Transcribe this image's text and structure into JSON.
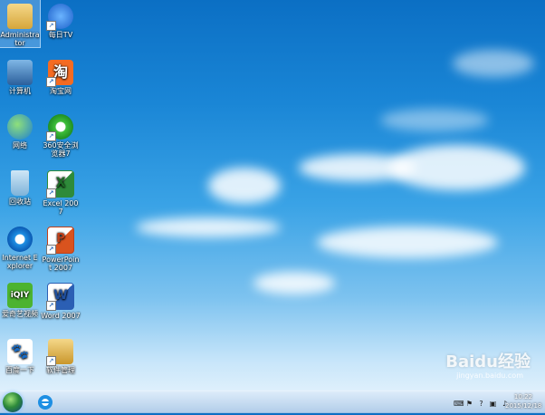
{
  "desktop": {
    "icons": [
      {
        "label": "Administrator",
        "icon": "folder-user-icon"
      },
      {
        "label": "每日TV",
        "icon": "tv-icon"
      },
      {
        "label": "计算机",
        "icon": "computer-icon"
      },
      {
        "label": "淘宝网",
        "icon": "taobao-icon"
      },
      {
        "label": "网络",
        "icon": "network-icon"
      },
      {
        "label": "360安全浏览器7",
        "icon": "360-browser-icon"
      },
      {
        "label": "回收站",
        "icon": "recycle-bin-icon"
      },
      {
        "label": "Excel 2007",
        "icon": "excel-icon"
      },
      {
        "label": "Internet Explorer",
        "icon": "ie-icon"
      },
      {
        "label": "PowerPoint 2007",
        "icon": "powerpoint-icon"
      },
      {
        "label": "爱奇艺视频",
        "icon": "iqiyi-icon"
      },
      {
        "label": "Word 2007",
        "icon": "word-icon"
      },
      {
        "label": "百度一下",
        "icon": "baidu-icon"
      },
      {
        "label": "软件管理",
        "icon": "software-manager-icon"
      }
    ]
  },
  "taskbar": {
    "clock_time": "10:22",
    "clock_date": "2015/12/18"
  },
  "watermark": {
    "text": "Baidu经验",
    "sub": "jingyan.baidu.com"
  }
}
